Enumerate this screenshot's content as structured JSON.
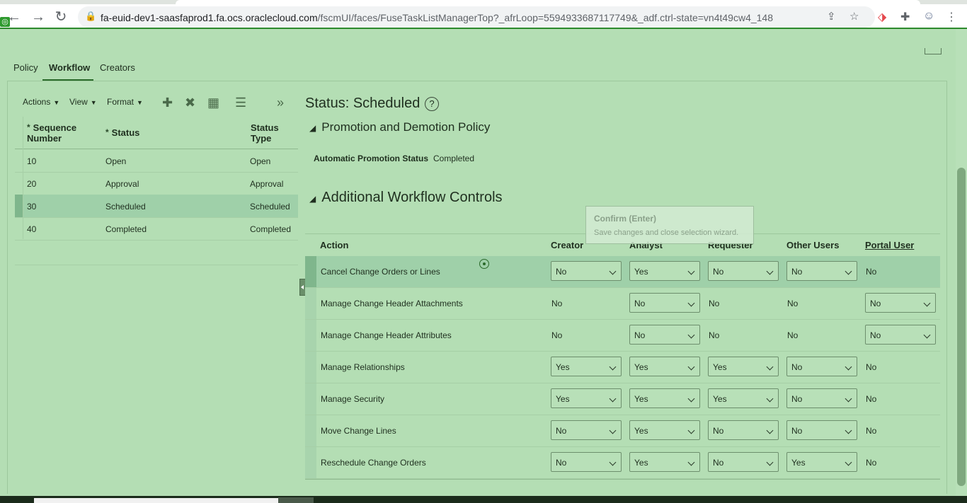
{
  "browser": {
    "url_host": "fa-euid-dev1-saasfaprod1.fa.ocs.oraclecloud.com",
    "url_path": "/fscmUI/faces/FuseTaskListManagerTop?_afrLoop=5594933687117749&_adf.ctrl-state=vn4t49cw4_148"
  },
  "tabs": [
    "Policy",
    "Workflow",
    "Creators"
  ],
  "toolbar": {
    "actions": "Actions",
    "view": "View",
    "format": "Format"
  },
  "statusTable": {
    "headers": {
      "seq1": "Sequence",
      "seq2": "Number",
      "status": "Status",
      "type1": "Status",
      "type2": "Type"
    },
    "rows": [
      {
        "seq": "10",
        "status": "Open",
        "type": "Open"
      },
      {
        "seq": "20",
        "status": "Approval",
        "type": "Approval"
      },
      {
        "seq": "30",
        "status": "Scheduled",
        "type": "Scheduled"
      },
      {
        "seq": "40",
        "status": "Completed",
        "type": "Completed"
      }
    ]
  },
  "detail": {
    "title": "Status: Scheduled",
    "promotion_section": "Promotion and Demotion Policy",
    "aps_label": "Automatic Promotion Status",
    "aps_value": "Completed",
    "workflow_section": "Additional Workflow Controls"
  },
  "tooltip": {
    "title": "Confirm (Enter)",
    "text": "Save changes and close selection wizard."
  },
  "workflowTable": {
    "headers": [
      "Action",
      "Creator",
      "Analyst",
      "Requester",
      "Other Users",
      "Portal User"
    ],
    "rows": [
      {
        "action": "Cancel Change Orders or Lines",
        "cells": [
          {
            "v": "No",
            "sel": true
          },
          {
            "v": "Yes",
            "sel": true
          },
          {
            "v": "No",
            "sel": true
          },
          {
            "v": "No",
            "sel": true
          },
          {
            "v": "No",
            "sel": false
          }
        ]
      },
      {
        "action": "Manage Change Header Attachments",
        "cells": [
          {
            "v": "No",
            "sel": false
          },
          {
            "v": "No",
            "sel": true
          },
          {
            "v": "No",
            "sel": false
          },
          {
            "v": "No",
            "sel": false
          },
          {
            "v": "No",
            "sel": true
          }
        ]
      },
      {
        "action": "Manage Change Header Attributes",
        "cells": [
          {
            "v": "No",
            "sel": false
          },
          {
            "v": "No",
            "sel": true
          },
          {
            "v": "No",
            "sel": false
          },
          {
            "v": "No",
            "sel": false
          },
          {
            "v": "No",
            "sel": true
          }
        ]
      },
      {
        "action": "Manage Relationships",
        "cells": [
          {
            "v": "Yes",
            "sel": true
          },
          {
            "v": "Yes",
            "sel": true
          },
          {
            "v": "Yes",
            "sel": true
          },
          {
            "v": "No",
            "sel": true
          },
          {
            "v": "No",
            "sel": false
          }
        ]
      },
      {
        "action": "Manage Security",
        "cells": [
          {
            "v": "Yes",
            "sel": true
          },
          {
            "v": "Yes",
            "sel": true
          },
          {
            "v": "Yes",
            "sel": true
          },
          {
            "v": "No",
            "sel": true
          },
          {
            "v": "No",
            "sel": false
          }
        ]
      },
      {
        "action": "Move Change Lines",
        "cells": [
          {
            "v": "No",
            "sel": true
          },
          {
            "v": "Yes",
            "sel": true
          },
          {
            "v": "No",
            "sel": true
          },
          {
            "v": "No",
            "sel": true
          },
          {
            "v": "No",
            "sel": false
          }
        ]
      },
      {
        "action": "Reschedule Change Orders",
        "cells": [
          {
            "v": "No",
            "sel": true
          },
          {
            "v": "Yes",
            "sel": true
          },
          {
            "v": "No",
            "sel": true
          },
          {
            "v": "Yes",
            "sel": true
          },
          {
            "v": "No",
            "sel": false
          }
        ]
      }
    ]
  }
}
